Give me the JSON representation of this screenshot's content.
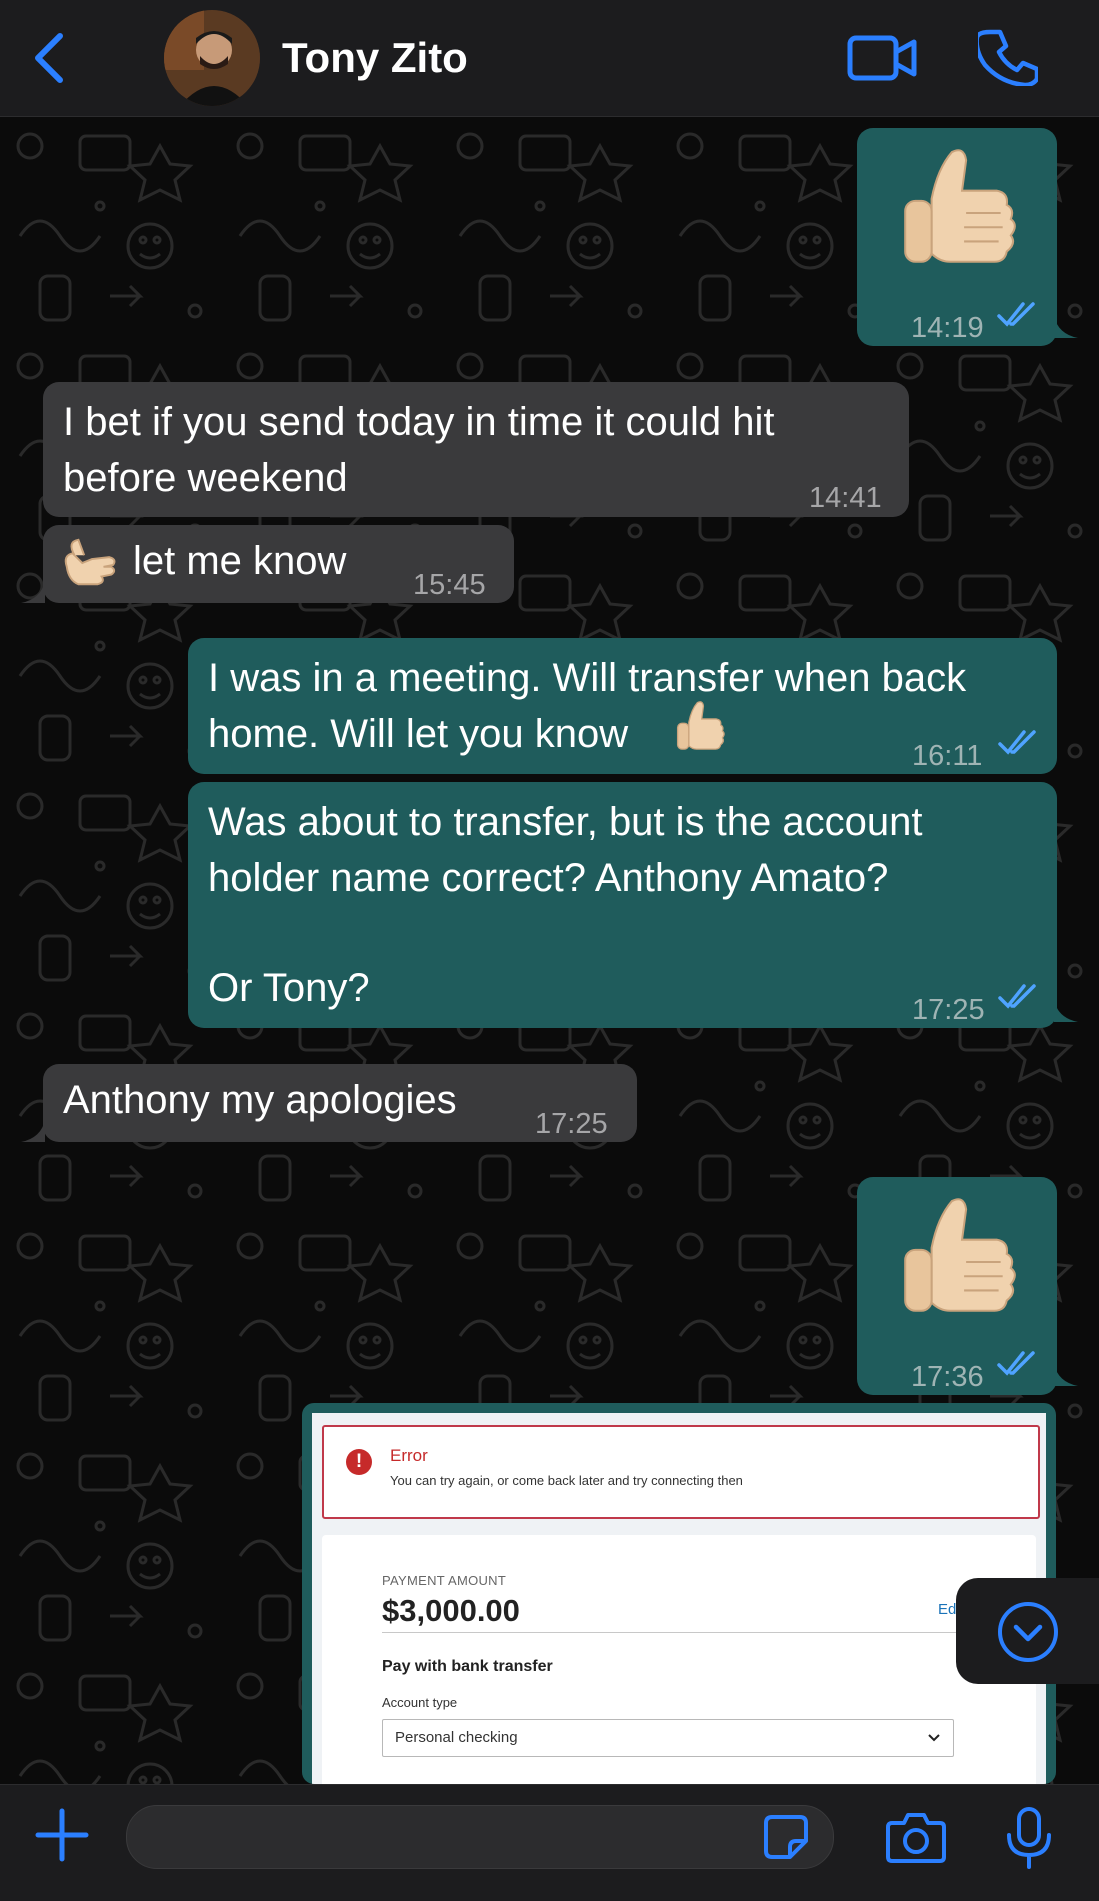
{
  "header": {
    "contact_name": "Tony Zito",
    "accent_color": "#2b7fff"
  },
  "messages": [
    {
      "direction": "out",
      "type": "emoji",
      "emoji": "thumbs-up",
      "time": "14:19",
      "read": true
    },
    {
      "direction": "in",
      "line1": "I bet if you send today in time it could hit",
      "line2": "before weekend",
      "time": "14:41"
    },
    {
      "direction": "in",
      "text": "let me know",
      "emoji": "call-me-hand",
      "time": "15:45"
    },
    {
      "direction": "out",
      "line1": "I was in a meeting. Will transfer when back",
      "line2": "home. Will let you know",
      "emoji": "thumbs-up",
      "time": "16:11",
      "read": true
    },
    {
      "direction": "out",
      "line1": "Was about to transfer, but is the account",
      "line2": "holder name correct? Anthony Amato?",
      "line3": "Or Tony?",
      "time": "17:25",
      "read": true
    },
    {
      "direction": "in",
      "text": "Anthony my apologies",
      "time": "17:25"
    },
    {
      "direction": "out",
      "type": "emoji",
      "emoji": "thumbs-up",
      "time": "17:36",
      "read": true
    }
  ],
  "attachment": {
    "error_title": "Error",
    "error_message": "You can try again, or come back later and try connecting then",
    "payment_label": "PAYMENT AMOUNT",
    "payment_amount": "$3,000.00",
    "edit_label": "Edi",
    "pay_with": "Pay with bank transfer",
    "account_type_label": "Account type",
    "account_type_value": "Personal checking"
  },
  "composer": {
    "input_value": ""
  },
  "colors": {
    "outgoing_bubble": "#1f5c5c",
    "incoming_bubble": "#3a3a3c",
    "read_ticks": "#4fa3ff",
    "error_red": "#c62a2a"
  }
}
